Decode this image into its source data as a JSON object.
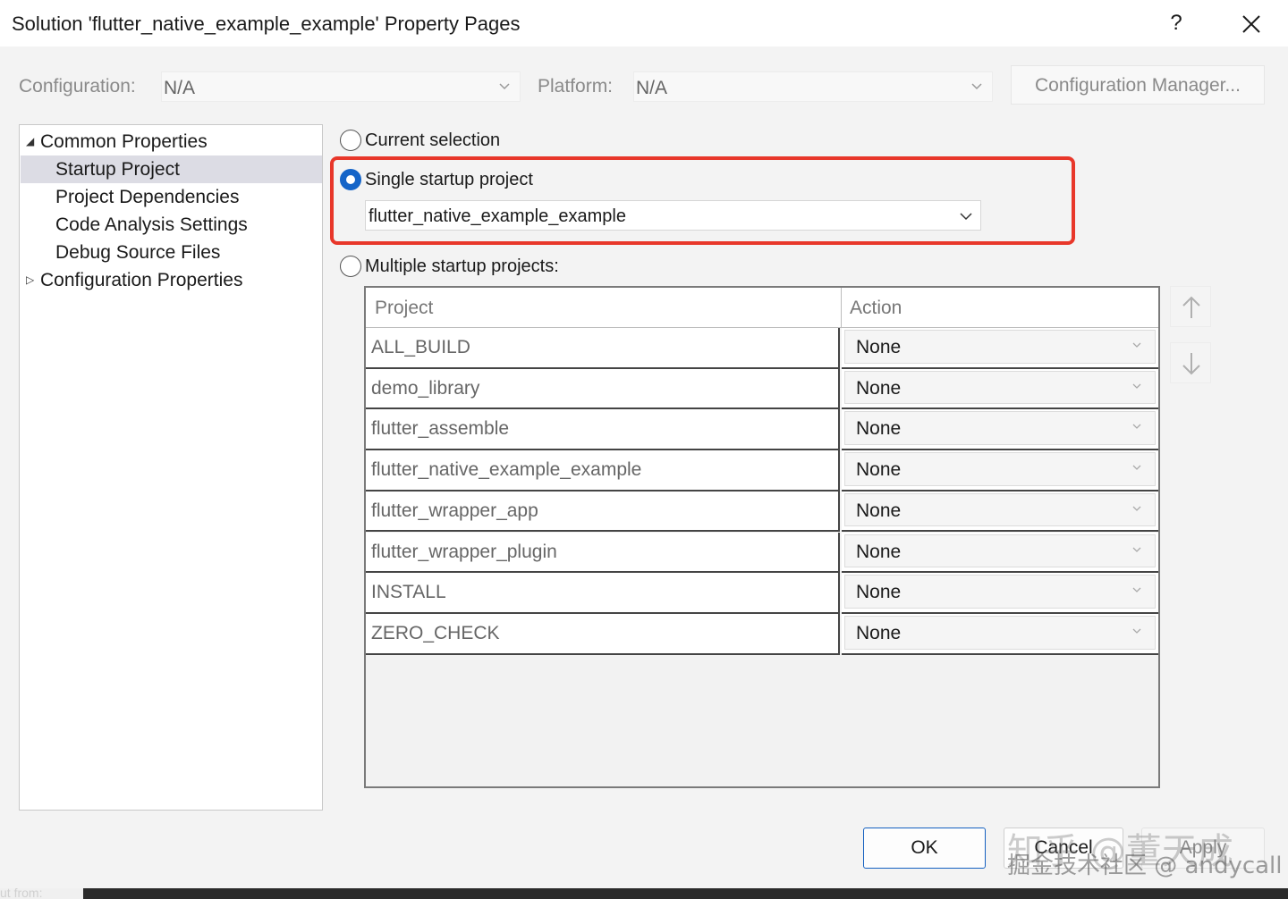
{
  "window": {
    "title": "Solution 'flutter_native_example_example' Property Pages",
    "help_label": "?"
  },
  "config_bar": {
    "configuration_label": "Configuration:",
    "configuration_value": "N/A",
    "platform_label": "Platform:",
    "platform_value": "N/A",
    "manager_button": "Configuration Manager..."
  },
  "tree": {
    "items": [
      {
        "label": "Common Properties",
        "arrow": "◢"
      },
      {
        "label": "Startup Project"
      },
      {
        "label": "Project Dependencies"
      },
      {
        "label": "Code Analysis Settings"
      },
      {
        "label": "Debug Source Files"
      },
      {
        "label": "Configuration Properties",
        "arrow": "▷"
      }
    ],
    "selected_index": 1
  },
  "startup": {
    "current_selection_label": "Current selection",
    "single_label": "Single startup project",
    "single_value": "flutter_native_example_example",
    "multiple_label": "Multiple startup projects:",
    "selected_option": "single"
  },
  "grid": {
    "headers": {
      "project": "Project",
      "action": "Action"
    },
    "rows": [
      {
        "project": "ALL_BUILD",
        "action": "None"
      },
      {
        "project": "demo_library",
        "action": "None"
      },
      {
        "project": "flutter_assemble",
        "action": "None"
      },
      {
        "project": "flutter_native_example_example",
        "action": "None"
      },
      {
        "project": "flutter_wrapper_app",
        "action": "None"
      },
      {
        "project": "flutter_wrapper_plugin",
        "action": "None"
      },
      {
        "project": "INSTALL",
        "action": "None"
      },
      {
        "project": "ZERO_CHECK",
        "action": "None"
      }
    ]
  },
  "buttons": {
    "ok": "OK",
    "cancel": "Cancel",
    "apply": "Apply"
  },
  "icons": {
    "close": "close-icon",
    "chevron": "chevron-down-icon",
    "move_up": "arrow-up-icon",
    "move_down": "arrow-down-icon"
  },
  "colors": {
    "accent": "#1464c8",
    "highlight": "#e8372a",
    "selection": "#dcdce4"
  },
  "watermark": {
    "line1": "知乎 @董天成",
    "line2": "掘金技术社区 @ andycall"
  },
  "background_text": "ut from:"
}
